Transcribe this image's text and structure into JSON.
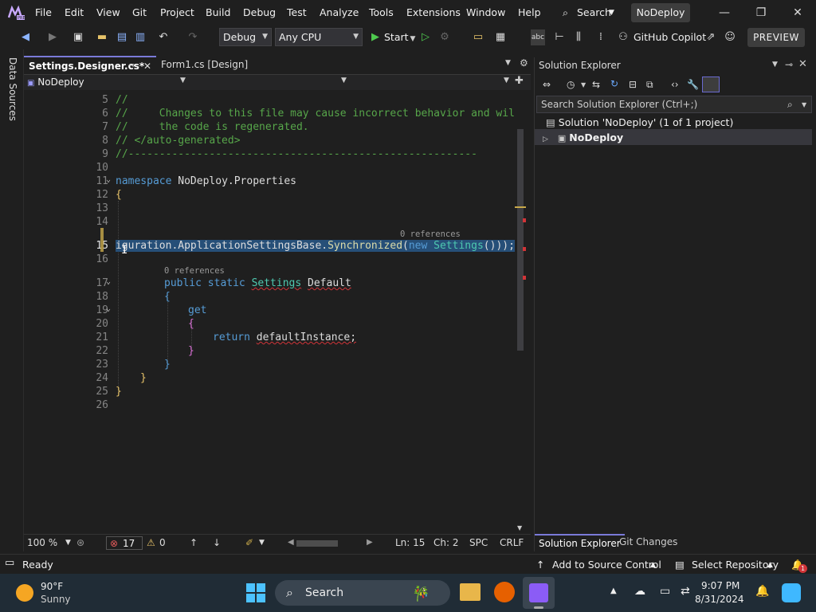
{
  "menu": {
    "items": [
      "File",
      "Edit",
      "View",
      "Git",
      "Project",
      "Build",
      "Debug",
      "Test",
      "Analyze",
      "Tools",
      "Extensions",
      "Window",
      "Help"
    ],
    "search": "Search",
    "solution_name": "NoDeploy"
  },
  "toolbar": {
    "config": "Debug",
    "platform": "Any CPU",
    "start": "Start",
    "copilot": "GitHub Copilot",
    "preview": "PREVIEW"
  },
  "left_strip": {
    "label": "Data Sources"
  },
  "doc_tabs": {
    "active": "Settings.Designer.cs*",
    "second": "Form1.cs [Design]"
  },
  "nav": {
    "project": "NoDeploy"
  },
  "editor": {
    "lines": [
      "5",
      "6",
      "7",
      "8",
      "9",
      "10",
      "11",
      "12",
      "13",
      "14",
      "15",
      "16",
      "17",
      "18",
      "19",
      "20",
      "21",
      "22",
      "23",
      "24",
      "25",
      "26"
    ],
    "code": {
      "l5": "//",
      "l6a": "//",
      "l6b": "Changes to this file may cause incorrect behavior and will",
      "l7a": "//",
      "l7b": "the code is regenerated.",
      "l8": "// </auto-generated>",
      "l9": "//--------------------------------------------------------",
      "l11_kw": "namespace",
      "l11_ns": "NoDeploy.Properties",
      "l12": "{",
      "l15_a": "iguration.ApplicationSettingsBase.",
      "l15_b": "Synchronized",
      "l15_c": "(",
      "l15_new": "new",
      "l15_d": "Settings",
      "l15_e": "()));",
      "ref_count": "0 references",
      "l17_kw": "public static",
      "l17_ty": "Settings",
      "l17_nm": "Default",
      "l18": "{",
      "l19": "get",
      "l20": "{",
      "l21_kw": "return",
      "l21_val": "defaultInstance;",
      "l22": "}",
      "l23": "}",
      "l24": "}",
      "l25": "}"
    }
  },
  "editor_status": {
    "zoom": "100 %",
    "errors": "17",
    "warnings": "0",
    "line": "Ln: 15",
    "col": "Ch: 2",
    "indent": "SPC",
    "eol": "CRLF"
  },
  "solution_explorer": {
    "title": "Solution Explorer",
    "search_placeholder": "Search Solution Explorer (Ctrl+;)",
    "solution": "Solution 'NoDeploy' (1 of 1 project)",
    "project": "NoDeploy",
    "tab1": "Solution Explorer",
    "tab2": "Git Changes"
  },
  "statusbar": {
    "ready": "Ready",
    "source_control": "Add to Source Control",
    "repo": "Select Repository",
    "notifications": "1"
  },
  "taskbar": {
    "temp": "90°F",
    "weather": "Sunny",
    "search": "Search",
    "time": "9:07 PM",
    "date": "8/31/2024"
  },
  "colors": {
    "accent": "#7a7ad8",
    "selection": "#264f78",
    "comment": "#57a64a",
    "keyword": "#569cd6",
    "type": "#4ec9b0"
  }
}
